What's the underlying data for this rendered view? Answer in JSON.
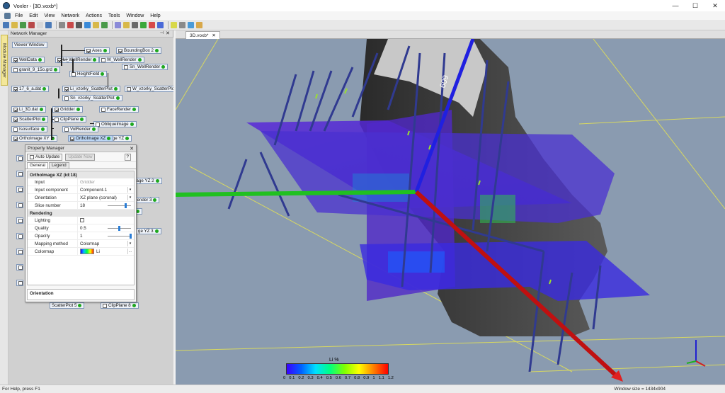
{
  "window": {
    "title": "Voxler - [3D.voxb*]",
    "min": "—",
    "max": "☐",
    "close": "✕"
  },
  "menu": {
    "items": [
      "File",
      "Edit",
      "View",
      "Network",
      "Actions",
      "Tools",
      "Window",
      "Help"
    ]
  },
  "toolbar": {
    "icon_colors": [
      "#4a7ab8",
      "#d8b84a",
      "#4a9a4a",
      "#b84a4a",
      "#d8d8d8",
      "#4a7ab8",
      "#8a8a8a",
      "#c84a4a",
      "#5a5a5a",
      "#3a8ad8",
      "#d8b84a",
      "#4a9a4a",
      "#8a8ad8",
      "#d8b84a",
      "#6a6a6a",
      "#3aa83a",
      "#d84a4a",
      "#4a6ad8",
      "#d8d84a",
      "#8a8a8a",
      "#4a9ad8",
      "#d8a84a"
    ]
  },
  "side_tab": {
    "label": "Module Manager"
  },
  "network_manager": {
    "title": "Network Manager",
    "pin": "⊣",
    "close": "✕",
    "nodes": [
      {
        "label": "Viewer Window",
        "check": false,
        "nocb": true,
        "port": false
      },
      {
        "label": "Axes",
        "check": true,
        "port": true
      },
      {
        "label": "BoundingBox 2",
        "check": true,
        "port": true
      },
      {
        "label": "WellData",
        "check": true,
        "port": true
      },
      {
        "label": "Li_WellRender",
        "check": true,
        "port": true
      },
      {
        "label": "W_WellRender",
        "check": false,
        "port": true
      },
      {
        "label": "granit_9_15o.grd",
        "check": false,
        "port": true
      },
      {
        "label": "Sn_WellRender",
        "check": false,
        "port": true
      },
      {
        "label": "HeightField",
        "check": false,
        "port": true
      },
      {
        "label": "17_6_a.dat",
        "check": true,
        "port": true
      },
      {
        "label": "Li_vzorky_ScatterPlot",
        "check": true,
        "port": true
      },
      {
        "label": "W_vzorky_ScatterPlot",
        "check": false,
        "port": true
      },
      {
        "label": "Sn_vzorky_ScatterPlot",
        "check": false,
        "port": true
      },
      {
        "label": "Li_3D.dat",
        "check": true,
        "port": true
      },
      {
        "label": "Gridder",
        "check": true,
        "port": true
      },
      {
        "label": "FaceRender",
        "check": false,
        "port": true
      },
      {
        "label": "ScatterPlot",
        "check": true,
        "port": true
      },
      {
        "label": "ClipPlane",
        "check": false,
        "port": true
      },
      {
        "label": "ObliqueImage",
        "check": false,
        "port": true
      },
      {
        "label": "Isosurface",
        "check": false,
        "port": true
      },
      {
        "label": "VolRender",
        "check": false,
        "port": true
      },
      {
        "label": "OrthoImage XY",
        "check": true,
        "port": true
      },
      {
        "label": "OrthoImage YZ",
        "check": false,
        "port": true
      },
      {
        "label": "OrthoImage XZ",
        "check": true,
        "port": true,
        "selected": true
      },
      {
        "label": "2",
        "check": false,
        "nocb": true,
        "port": true
      },
      {
        "label": "rthoImage YZ 2",
        "check": false,
        "nocb": true,
        "port": true
      },
      {
        "label": "aceRender 3",
        "check": false,
        "nocb": true,
        "port": true
      },
      {
        "label": "3",
        "check": false,
        "nocb": true,
        "port": true
      },
      {
        "label": "ge YZ 3",
        "check": false,
        "nocb": true,
        "port": true
      },
      {
        "label": "ScatterPlot 5",
        "check": false,
        "nocb": true,
        "port": true
      },
      {
        "label": "ClipPlane 8",
        "check": false,
        "port": true
      }
    ]
  },
  "property_manager": {
    "title": "Property Manager",
    "close": "✕",
    "auto_update": "Auto Update",
    "update_now": "Update Now",
    "help": "?",
    "tabs": [
      "General",
      "Legend"
    ],
    "header": "OrthoImage XZ (id:18)",
    "rows": [
      {
        "k": "Input",
        "v": "Gridder",
        "disabled": true
      },
      {
        "k": "Input component",
        "v": "Component-1",
        "dropdown": true
      },
      {
        "k": "Orientation",
        "v": "XZ plane (coronal)",
        "dropdown": true
      },
      {
        "k": "Slice number",
        "v": "18",
        "slider": 0.8
      }
    ],
    "section2": "Rendering",
    "rows2": [
      {
        "k": "Lighting",
        "checkbox": true
      },
      {
        "k": "Quality",
        "v": "0.5",
        "slider": 0.5
      },
      {
        "k": "Opacity",
        "v": "1",
        "slider": 1.0
      },
      {
        "k": "Mapping method",
        "v": "Colormap",
        "dropdown": true
      },
      {
        "k": "Colormap",
        "v": "Li",
        "cmap": true,
        "more": "..."
      }
    ],
    "footer": "Orientation"
  },
  "view": {
    "tab": "3D.voxb*",
    "tab_close": "✕",
    "axis_label": "609",
    "colorbar": {
      "title": "Li %",
      "ticks": [
        "0",
        "0.1",
        "0.2",
        "0.3",
        "0.4",
        "0.5",
        "0.6",
        "0.7",
        "0.8",
        "0.9",
        "1",
        "1.1",
        "1.2"
      ]
    }
  },
  "status": {
    "left": "For Help, press F1",
    "right": "Window size = 1434x904"
  }
}
